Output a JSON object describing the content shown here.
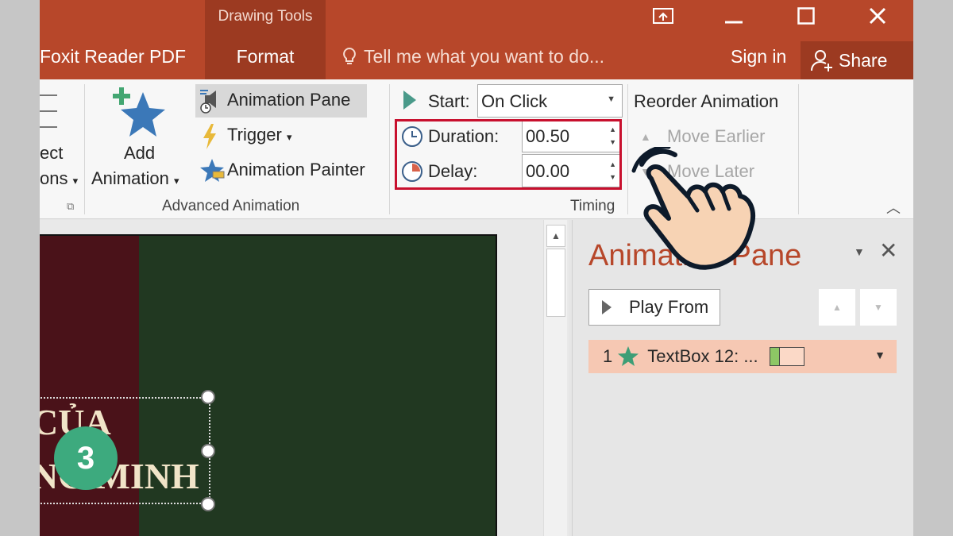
{
  "titlebar": {
    "contextual_group": "Drawing Tools",
    "tabs": [
      "Foxit Reader PDF",
      "Format"
    ],
    "tell_me": "Tell me what you want to do...",
    "sign_in": "Sign in",
    "share": "Share"
  },
  "ribbon": {
    "left_partial": {
      "line1": "ect",
      "line2": "ons",
      "chevron": "▾"
    },
    "add_animation": {
      "line1": "Add",
      "line2": "Animation"
    },
    "advanced": {
      "animation_pane": "Animation Pane",
      "trigger": "Trigger",
      "animation_painter": "Animation Painter",
      "group_label": "Advanced Animation"
    },
    "timing": {
      "start_label": "Start:",
      "start_value": "On Click",
      "duration_label": "Duration:",
      "duration_value": "00.50",
      "delay_label": "Delay:",
      "delay_value": "00.00",
      "group_label": "Timing"
    },
    "reorder": {
      "title": "Reorder Animation",
      "move_earlier": "Move Earlier",
      "move_later": "Move Later"
    }
  },
  "slide": {
    "text_line1": "CỦA",
    "text_line2": "NG MINH",
    "step_badge": "3"
  },
  "animation_pane": {
    "title": "Animation Pane",
    "play_from": "Play From",
    "items": [
      {
        "number": "1",
        "label": "TextBox 12: ...",
        "timing_fraction": 0.3
      }
    ]
  },
  "colors": {
    "titlebar": "#b7472a",
    "highlight_box": "#c8102e",
    "slide_green": "#213821",
    "slide_red": "#4a1219",
    "badge": "#3daa7e",
    "selected_item": "#f6c8b3"
  }
}
